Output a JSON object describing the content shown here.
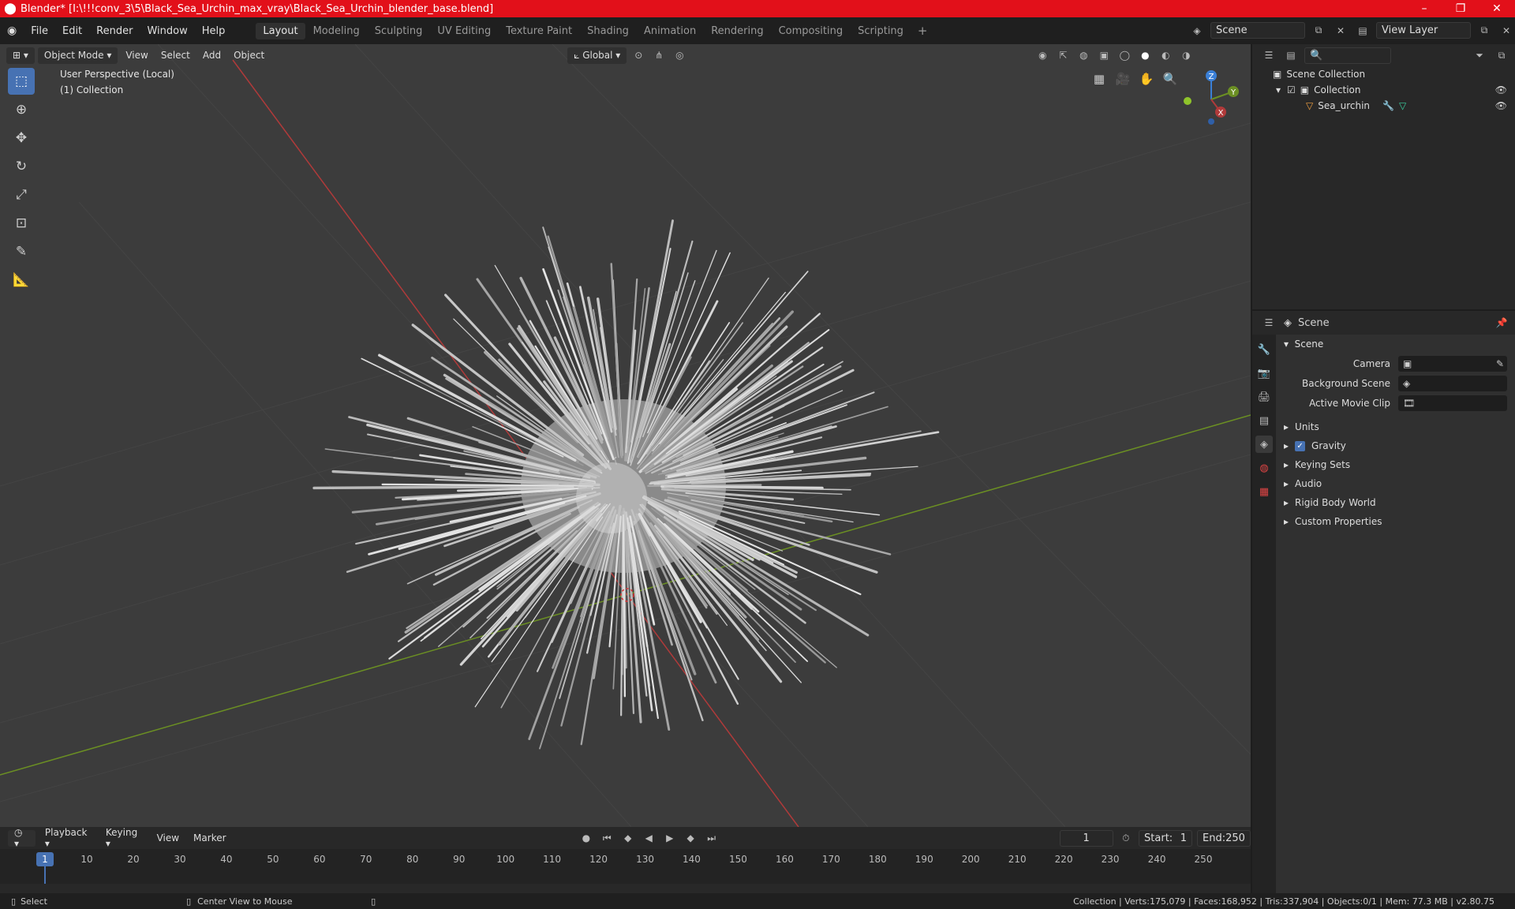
{
  "window": {
    "title": "Blender* [I:\\!!!conv_3\\5\\Black_Sea_Urchin_max_vray\\Black_Sea_Urchin_blender_base.blend]",
    "logo_icon": "blender-icon",
    "minimize": "–",
    "maximize": "❐",
    "close": "✕"
  },
  "menubar": {
    "items": [
      "File",
      "Edit",
      "Render",
      "Window",
      "Help"
    ]
  },
  "workspaces": {
    "tabs": [
      "Layout",
      "Modeling",
      "Sculpting",
      "UV Editing",
      "Texture Paint",
      "Shading",
      "Animation",
      "Rendering",
      "Compositing",
      "Scripting"
    ],
    "active": "Layout",
    "add": "+"
  },
  "scene_selector": {
    "value": "Scene"
  },
  "viewlayer_selector": {
    "value": "View Layer"
  },
  "viewport_header": {
    "mode": "Object Mode",
    "menus": [
      "View",
      "Select",
      "Add",
      "Object"
    ],
    "transform_orientation": "Global"
  },
  "viewport": {
    "perspective": "User Perspective (Local)",
    "collection": "(1) Collection",
    "gizmo": {
      "x": "X",
      "y": "Y",
      "z": "Z"
    }
  },
  "outliner": {
    "scene_collection": "Scene Collection",
    "collection": "Collection",
    "object": "Sea_urchin"
  },
  "properties": {
    "header": "Scene",
    "panel": "Scene",
    "camera_label": "Camera",
    "background_scene_label": "Background Scene",
    "active_movie_clip_label": "Active Movie Clip",
    "sections": [
      "Units",
      "Gravity",
      "Keying Sets",
      "Audio",
      "Rigid Body World",
      "Custom Properties"
    ],
    "gravity_checked": true
  },
  "timeline": {
    "menus": [
      "Playback",
      "Keying",
      "View",
      "Marker"
    ],
    "current_frame": "1",
    "start_label": "Start:",
    "start": "1",
    "end_label": "End:",
    "end": "250",
    "ticks": [
      "1",
      "10",
      "20",
      "30",
      "40",
      "50",
      "60",
      "70",
      "80",
      "90",
      "100",
      "110",
      "120",
      "130",
      "140",
      "150",
      "160",
      "170",
      "180",
      "190",
      "200",
      "210",
      "220",
      "230",
      "240",
      "250"
    ]
  },
  "statusbar": {
    "left": "Select",
    "middle": "Center View to Mouse",
    "right": "Collection | Verts:175,079 | Faces:168,952 | Tris:337,904 | Objects:0/1 | Mem: 77.3 MB | v2.80.75"
  },
  "colors": {
    "titlebar": "#e2101a",
    "accent": "#4772b3",
    "x_axis": "#b03a3a",
    "y_axis": "#6b8f23",
    "z_axis": "#3a7fd6"
  }
}
